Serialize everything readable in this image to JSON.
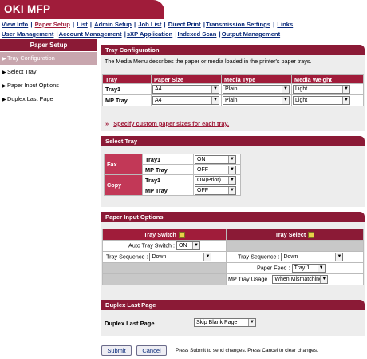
{
  "header": {
    "title": "OKI MFP"
  },
  "nav": {
    "row1": [
      "View Info",
      "Paper Setup",
      "List",
      "Admin Setup",
      "Job List",
      "Direct Print",
      "Transmission Settings",
      "Links"
    ],
    "row2": [
      "User Management",
      "Account Management",
      "sXP Application",
      "Indexed Scan",
      "Output Management"
    ],
    "active": "Paper Setup"
  },
  "sidebar": {
    "title": "Paper Setup",
    "items": [
      {
        "label": "Tray Configuration",
        "active": true
      },
      {
        "label": "Select Tray",
        "active": false
      },
      {
        "label": "Paper Input Options",
        "active": false
      },
      {
        "label": "Duplex Last Page",
        "active": false
      }
    ]
  },
  "tray_config": {
    "title": "Tray Configuration",
    "desc": "The Media Menu describes the paper or media loaded in the printer's paper trays.",
    "headers": [
      "Tray",
      "Paper Size",
      "Media Type",
      "Media Weight"
    ],
    "rows": [
      {
        "tray": "Tray1",
        "size": "A4",
        "type": "Plain",
        "weight": "Light"
      },
      {
        "tray": "MP Tray",
        "size": "A4",
        "type": "Plain",
        "weight": "Light"
      }
    ],
    "link_prefix": "»",
    "link": "Specify custom paper sizes for each tray."
  },
  "select_tray": {
    "title": "Select Tray",
    "fax": {
      "label": "Fax",
      "tray1_label": "Tray1",
      "tray1": "ON",
      "mp_label": "MP Tray",
      "mp": "OFF"
    },
    "copy": {
      "label": "Copy",
      "tray1_label": "Tray1",
      "tray1": "ON(Prior)",
      "mp_label": "MP Tray",
      "mp": "OFF"
    }
  },
  "input_options": {
    "title": "Paper Input Options",
    "switch_header": "Tray Switch",
    "select_header": "Tray Select",
    "auto_switch_label": "Auto Tray Switch :",
    "auto_switch": "ON",
    "seq_label_left": "Tray Sequence :",
    "seq_left": "Down",
    "seq_label_right": "Tray Sequence :",
    "seq_right": "Down",
    "feed_label": "Paper Feed :",
    "feed": "Tray 1",
    "mp_usage_label": "MP Tray Usage :",
    "mp_usage": "When Mismatching"
  },
  "duplex": {
    "title": "Duplex Last Page",
    "label": "Duplex Last Page",
    "value": "Skip Blank Page"
  },
  "actions": {
    "submit": "Submit",
    "cancel": "Cancel",
    "hint": "Press Submit to send changes. Press Cancel to clear changes."
  },
  "colors": {
    "brand": "#a01c3a",
    "header_dark": "#8b1a36",
    "cell_red": "#c23857",
    "link_red": "#a01c3a",
    "nav_blue": "#0a2a7a"
  }
}
